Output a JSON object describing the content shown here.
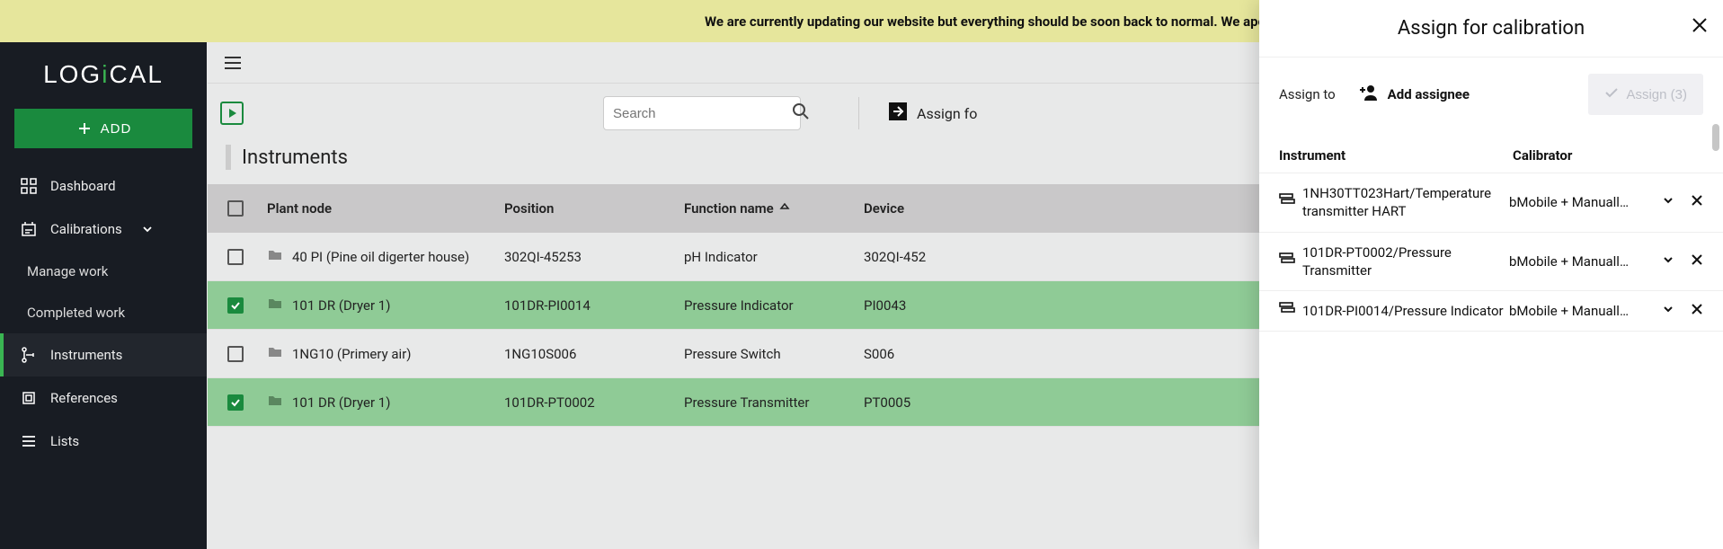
{
  "banner": {
    "text": "We are currently updating our website but everything should be soon back to normal. We apologi"
  },
  "sidebar": {
    "add_label": "ADD",
    "items": [
      {
        "label": "Dashboard"
      },
      {
        "label": "Calibrations"
      },
      {
        "label": "Manage work"
      },
      {
        "label": "Completed work"
      },
      {
        "label": "Instruments"
      },
      {
        "label": "References"
      },
      {
        "label": "Lists"
      }
    ]
  },
  "toolbar": {
    "search_placeholder": "Search",
    "assign_for_label": "Assign fo"
  },
  "page_title": "Instruments",
  "table": {
    "headers": {
      "plant_node": "Plant node",
      "position": "Position",
      "function_name": "Function name",
      "device": "Device"
    },
    "rows": [
      {
        "selected": false,
        "plant": "40 PI (Pine oil digerter house)",
        "pos": "302QI-45253",
        "fn": "pH Indicator",
        "dev": "302QI-452"
      },
      {
        "selected": true,
        "plant": "101 DR (Dryer 1)",
        "pos": "101DR-PI0014",
        "fn": "Pressure Indicator",
        "dev": "PI0043"
      },
      {
        "selected": false,
        "plant": "1NG10 (Primery air)",
        "pos": "1NG10S006",
        "fn": "Pressure Switch",
        "dev": "S006"
      },
      {
        "selected": true,
        "plant": "101 DR (Dryer 1)",
        "pos": "101DR-PT0002",
        "fn": "Pressure Transmitter",
        "dev": "PT0005"
      }
    ]
  },
  "panel": {
    "title": "Assign for calibration",
    "assign_to_label": "Assign to",
    "add_assignee_label": "Add assignee",
    "assign_button": "Assign (3)",
    "columns": {
      "instrument": "Instrument",
      "calibrator": "Calibrator"
    },
    "items": [
      {
        "instrument": "1NH30TT023Hart/Temperature transmitter HART",
        "calibrator": "bMobile + Manuall…"
      },
      {
        "instrument": "101DR-PT0002/Pressure Transmitter",
        "calibrator": "bMobile + Manuall…"
      },
      {
        "instrument": "101DR-PI0014/Pressure Indicator",
        "calibrator": "bMobile + Manuall…"
      }
    ]
  }
}
